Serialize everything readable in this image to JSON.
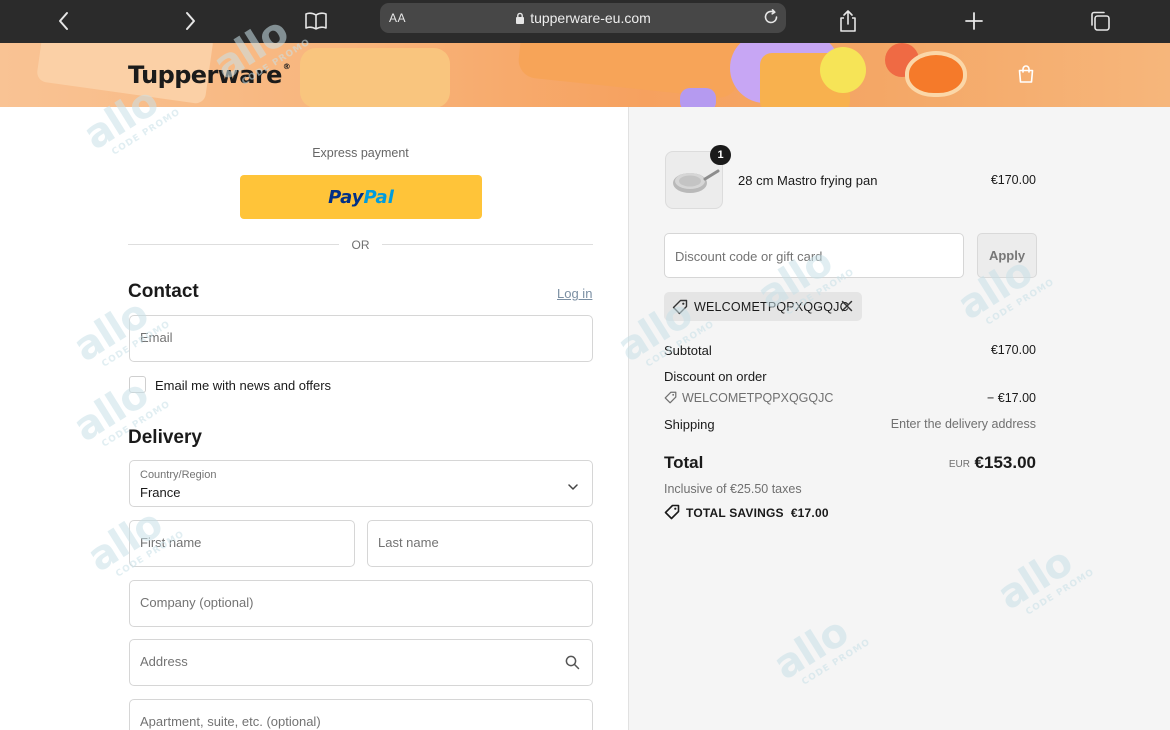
{
  "browser": {
    "aa_label": "AA",
    "url": "tupperware-eu.com",
    "icons": [
      "chevron-left-icon",
      "chevron-right-icon",
      "book-icon",
      "lock-icon",
      "reload-icon",
      "share-icon",
      "plus-icon",
      "tabs-icon"
    ]
  },
  "header": {
    "logo_text": "Tupperware",
    "logo_mark": "®",
    "cart_icon": "bag-icon"
  },
  "express": {
    "title": "Express payment",
    "paypal_part1": "Pay",
    "paypal_part2": "Pal",
    "separator": "OR"
  },
  "contact": {
    "heading": "Contact",
    "login_link": "Log in",
    "email_placeholder": "Email",
    "newsletter_label": "Email me with news and offers"
  },
  "delivery": {
    "heading": "Delivery",
    "country_label": "Country/Region",
    "country_value": "France",
    "first_name_placeholder": "First name",
    "last_name_placeholder": "Last name",
    "company_placeholder": "Company (optional)",
    "address_placeholder": "Address",
    "apartment_placeholder": "Apartment, suite, etc. (optional)"
  },
  "order": {
    "item": {
      "quantity": "1",
      "name": "28 cm Mastro frying pan",
      "price": "€170.00"
    },
    "discount_placeholder": "Discount code or gift card",
    "apply_label": "Apply",
    "applied_code": "WELCOMETPQPXQGQJC",
    "subtotal_label": "Subtotal",
    "subtotal_value": "€170.00",
    "discount_label": "Discount on order",
    "discount_code": "WELCOMETPQPXQGQJC",
    "discount_value": "− €17.00",
    "shipping_label": "Shipping",
    "shipping_value": "Enter the delivery address",
    "total_label": "Total",
    "total_currency": "EUR",
    "total_value": "€153.00",
    "tax_note": "Inclusive of €25.50 taxes",
    "savings_label": "TOTAL SAVINGS",
    "savings_value": "€17.00"
  },
  "watermark": {
    "word": "allo",
    "sub": "CODE PROMO"
  },
  "colors": {
    "paypal_yellow": "#ffc439",
    "paypal_dark_blue": "#003087",
    "paypal_light_blue": "#009cde",
    "browser_bar": "#2b2b2b",
    "summary_bg": "#f5f5f5",
    "hero_orange": "#f6a15f"
  }
}
